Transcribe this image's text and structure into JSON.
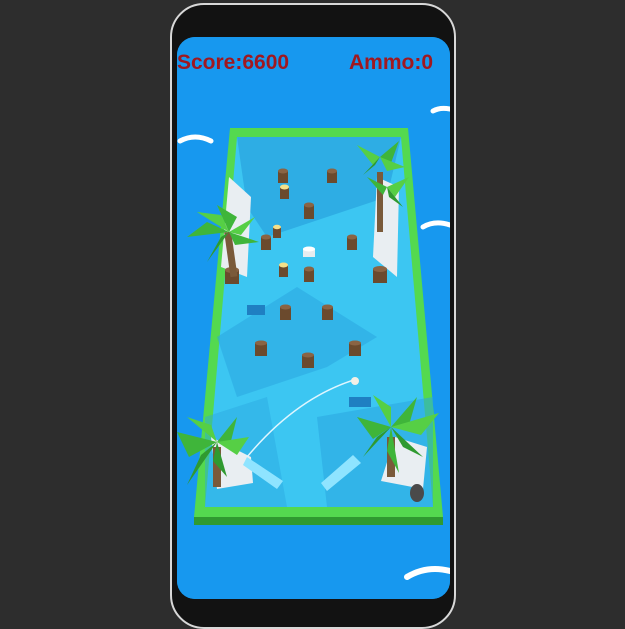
{
  "hud": {
    "score": "Score:6600",
    "ammo": "Ammo:0"
  },
  "colors": {
    "sea": "#1798ef",
    "pool_water": "#3cc6f2",
    "rim": "#5fe05a",
    "hud_text": "#a01820",
    "stump": "#6b4a2d",
    "palm_leaf": "#3fb53a"
  },
  "scene": {
    "targets_remaining": 14,
    "lit_targets": 3,
    "palm_trees": 6
  }
}
